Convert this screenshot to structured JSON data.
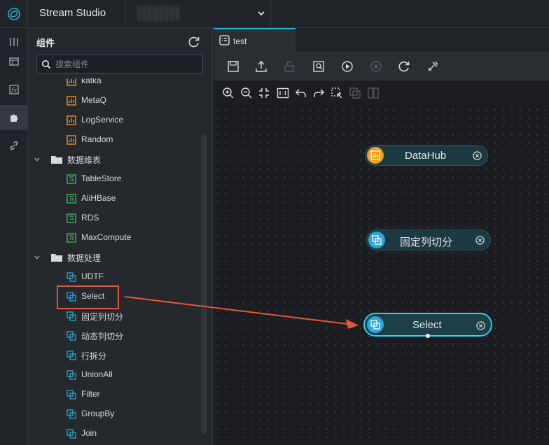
{
  "app": {
    "title": "Stream Studio"
  },
  "panel": {
    "title": "组件",
    "search_placeholder": "搜索组件"
  },
  "tree": [
    {
      "label": "kafka",
      "kind": "source"
    },
    {
      "label": "MetaQ",
      "kind": "source"
    },
    {
      "label": "LogService",
      "kind": "source"
    },
    {
      "label": "Random",
      "kind": "source"
    },
    {
      "label": "数据维表",
      "kind": "folder"
    },
    {
      "label": "TableStore",
      "kind": "dim"
    },
    {
      "label": "AliHBase",
      "kind": "dim"
    },
    {
      "label": "RDS",
      "kind": "dim"
    },
    {
      "label": "MaxCompute",
      "kind": "dim"
    },
    {
      "label": "数据处理",
      "kind": "folder"
    },
    {
      "label": "UDTF",
      "kind": "process"
    },
    {
      "label": "Select",
      "kind": "process"
    },
    {
      "label": "固定列切分",
      "kind": "process"
    },
    {
      "label": "动态列切分",
      "kind": "process"
    },
    {
      "label": "行拆分",
      "kind": "process"
    },
    {
      "label": "UnionAll",
      "kind": "process"
    },
    {
      "label": "Filter",
      "kind": "process"
    },
    {
      "label": "GroupBy",
      "kind": "process"
    },
    {
      "label": "Join",
      "kind": "process"
    }
  ],
  "editor": {
    "tab_label": "test"
  },
  "canvas": {
    "nodes": [
      {
        "label": "DataHub",
        "kind": "source"
      },
      {
        "label": "固定列切分",
        "kind": "process"
      },
      {
        "label": "Select",
        "kind": "process"
      }
    ]
  },
  "colors": {
    "accent": "#1fb4d0",
    "source_icon": "#f0a020",
    "dim_icon": "#3fbf6a",
    "process_icon": "#2aa8d8",
    "highlight": "#e8553a"
  }
}
